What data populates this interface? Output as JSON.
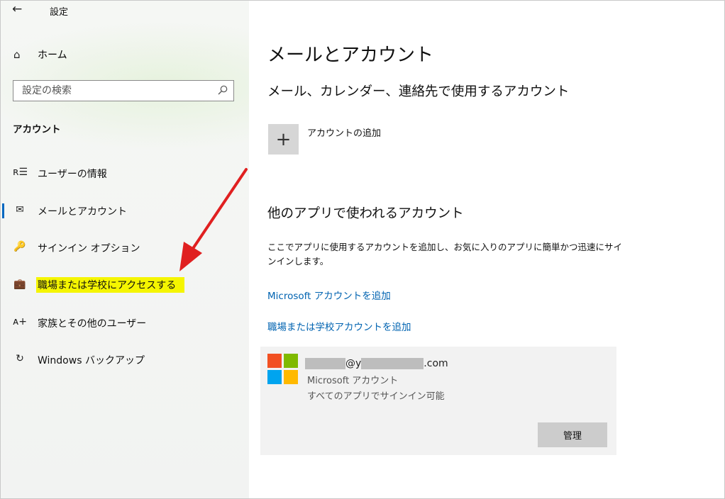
{
  "window": {
    "back_icon": "←",
    "title": "設定"
  },
  "sidebar": {
    "home": {
      "icon": "⌂",
      "label": "ホーム"
    },
    "search": {
      "placeholder": "設定の検索"
    },
    "section_heading": "アカウント",
    "items": [
      {
        "icon": "ʀ☰",
        "icon_name": "user-info-icon",
        "label": "ユーザーの情報",
        "active": false
      },
      {
        "icon": "✉",
        "icon_name": "mail-icon",
        "label": "メールとアカウント",
        "active": true
      },
      {
        "icon": "🔑",
        "icon_name": "key-icon",
        "label": "サインイン オプション",
        "active": false
      },
      {
        "icon": "💼",
        "icon_name": "briefcase-icon",
        "label": "職場または学校にアクセスする",
        "active": false,
        "highlighted": true
      },
      {
        "icon": "ᴀ+",
        "icon_name": "add-person-icon",
        "label": "家族とその他のユーザー",
        "active": false
      },
      {
        "icon": "↻",
        "icon_name": "sync-icon",
        "label": "Windows バックアップ",
        "active": false
      }
    ]
  },
  "main": {
    "title": "メールとアカウント",
    "subtitle1": "メール、カレンダー、連絡先で使用するアカウント",
    "add_account": {
      "icon": "+",
      "label": "アカウントの追加"
    },
    "subtitle2": "他のアプリで使われるアカウント",
    "description": "ここでアプリに使用するアカウントを追加し、お気に入りのアプリに簡単かつ迅速にサインインします。",
    "link_microsoft": "Microsoft アカウントを追加",
    "link_work": "職場または学校アカウントを追加",
    "account": {
      "email_at": "@y",
      "email_suffix": ".com",
      "type": "Microsoft アカウント",
      "desc": "すべてのアプリでサインイン可能",
      "manage_label": "管理"
    }
  },
  "colors": {
    "accent": "#0067c0",
    "link": "#0063b1",
    "highlight": "#f5f500",
    "annotation_arrow": "#e02020"
  }
}
